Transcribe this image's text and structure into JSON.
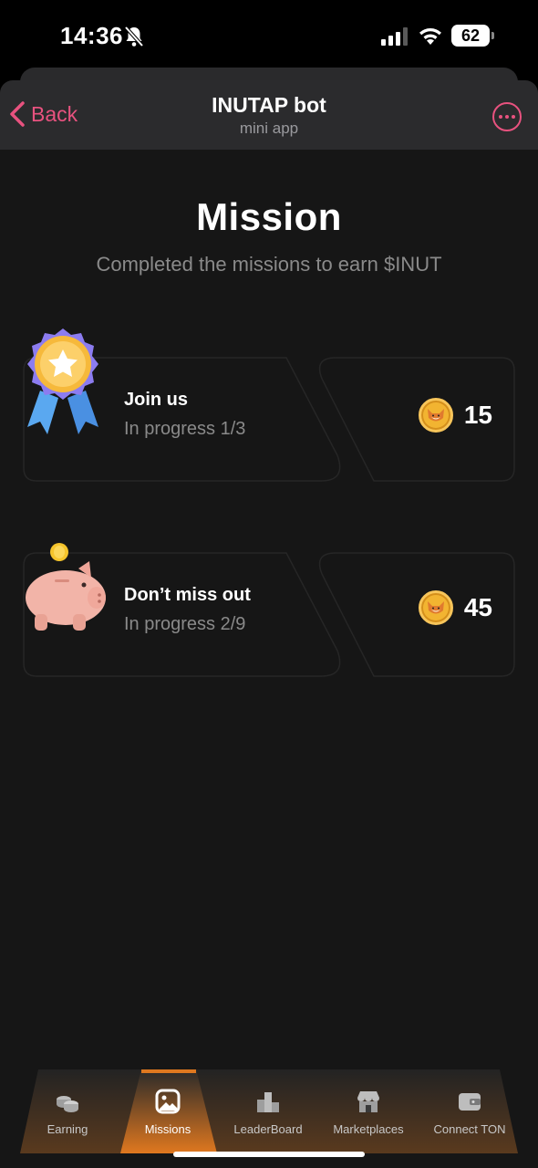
{
  "status": {
    "time": "14:36",
    "battery": "62"
  },
  "telegram": {
    "back_label": "Back",
    "title": "INUTAP bot",
    "subtitle": "mini app"
  },
  "page": {
    "title": "Mission",
    "subtitle": "Completed the missions to earn $INUT"
  },
  "missions": [
    {
      "name": "Join us",
      "progress": "In progress 1/3",
      "reward": "15",
      "icon": "ribbon-medal-icon"
    },
    {
      "name": "Don’t miss out",
      "progress": "In progress 2/9",
      "reward": "45",
      "icon": "piggy-bank-icon"
    }
  ],
  "nav": {
    "active": "Missions",
    "items": [
      {
        "label": "Earning",
        "icon": "coins-icon"
      },
      {
        "label": "Missions",
        "icon": "image-icon"
      },
      {
        "label": "LeaderBoard",
        "icon": "podium-icon"
      },
      {
        "label": "Marketplaces",
        "icon": "store-icon"
      },
      {
        "label": "Connect TON",
        "icon": "wallet-icon"
      }
    ]
  },
  "colors": {
    "accent": "#e8527f",
    "nav_active": "#e0781f",
    "coin": "#f2b431",
    "background": "#161616"
  }
}
